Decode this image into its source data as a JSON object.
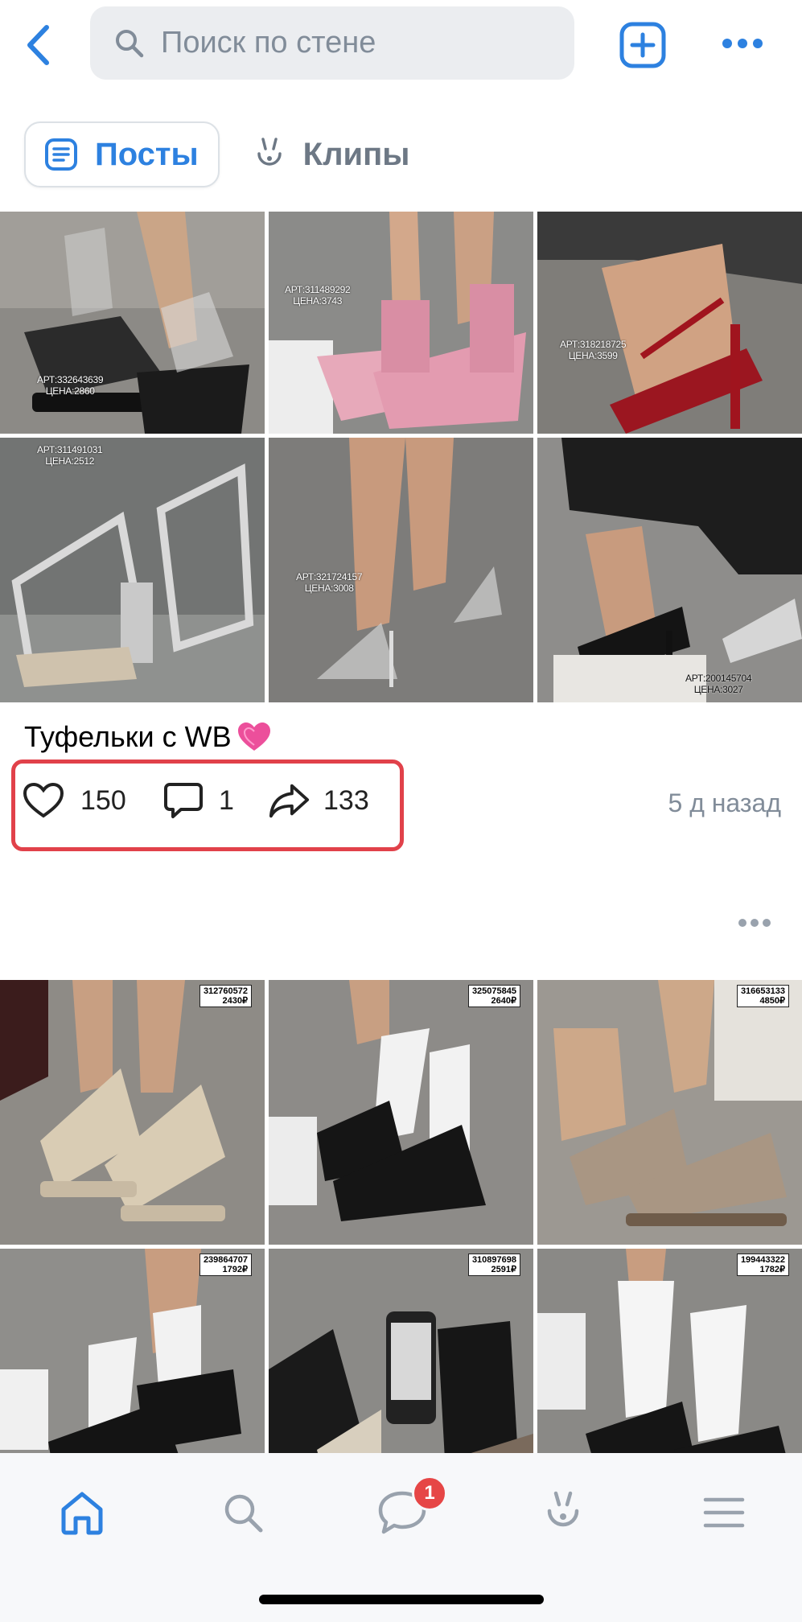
{
  "header": {
    "search_placeholder": "Поиск по стене"
  },
  "tabs": [
    {
      "label": "Посты",
      "icon": "posts-icon",
      "active": true
    },
    {
      "label": "Клипы",
      "icon": "clips-icon",
      "active": false
    }
  ],
  "post1": {
    "photos": [
      {
        "alt": "black sandals with platform",
        "art": "АРТ:332643639",
        "price": "ЦЕНА:2860"
      },
      {
        "alt": "pink tweed bow heels",
        "art": "АРТ:311489292",
        "price": "ЦЕНА:3743"
      },
      {
        "alt": "red strappy heels",
        "art": "АРТ:318218725",
        "price": "ЦЕНА:3599"
      },
      {
        "alt": "silver strappy block heels",
        "art": "АРТ:311491031",
        "price": "ЦЕНА:2512"
      },
      {
        "alt": "clear strap heels",
        "art": "АРТ:321724157",
        "price": "ЦЕНА:3008"
      },
      {
        "alt": "black heels with lace trousers",
        "art": "АРТ:200145704",
        "price": "ЦЕНА:3027"
      }
    ],
    "caption": "Туфельки с WB",
    "likes": "150",
    "comments": "1",
    "shares": "133",
    "time_ago": "5 д назад"
  },
  "post2": {
    "photos": [
      {
        "alt": "beige tassel loafers",
        "art": "312760572",
        "price": "2430₽"
      },
      {
        "alt": "black mary janes with white socks",
        "art": "325075845",
        "price": "2640₽"
      },
      {
        "alt": "taupe suede loafers",
        "art": "316653133",
        "price": "4850₽"
      },
      {
        "alt": "black double-strap mary janes",
        "art": "239864707",
        "price": "1792₽"
      },
      {
        "alt": "black loafers with phone",
        "art": "310897698",
        "price": "2591₽"
      },
      {
        "alt": "black mary janes with ruffle socks",
        "art": "199443322",
        "price": "1782₽"
      }
    ]
  },
  "bottom_nav": {
    "items": [
      "home-icon",
      "search-icon",
      "messages-icon",
      "clips-icon",
      "menu-icon"
    ],
    "messages_badge": "1"
  },
  "colors": {
    "accent": "#2d81e0",
    "highlight_box": "#e1414a",
    "secondary_text": "#818c99",
    "badge": "#e64646"
  }
}
